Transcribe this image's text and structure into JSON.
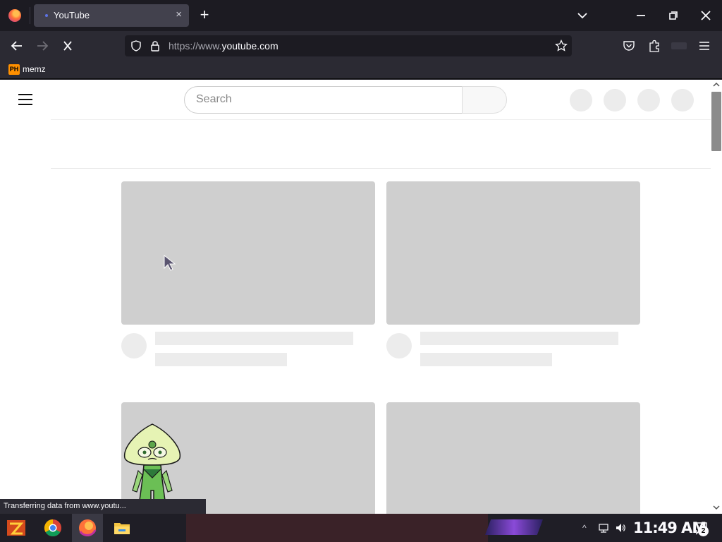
{
  "browser": {
    "tab_title": "YouTube",
    "tab_close_label": "×",
    "new_tab_label": "+",
    "url_prefix": "https://www.",
    "url_domain": "youtube.com"
  },
  "bookmarks": {
    "items": [
      {
        "icon_text": "PH",
        "label": "memz"
      }
    ]
  },
  "page": {
    "search_placeholder": "Search"
  },
  "status_bar": {
    "text": "Transferring data from www.youtu..."
  },
  "taskbar": {
    "clock": "11:49 AM",
    "notification_count": "2",
    "tray_overflow": "^",
    "apps": [
      "start-icon",
      "chrome-icon",
      "firefox-icon",
      "file-explorer-icon"
    ]
  },
  "colors": {
    "browser_dark": "#1c1b22",
    "toolbar": "#2b2a33",
    "active_tab": "#42414d",
    "skeleton_thumb": "#cfcfcf",
    "skeleton_line": "#ececec"
  }
}
